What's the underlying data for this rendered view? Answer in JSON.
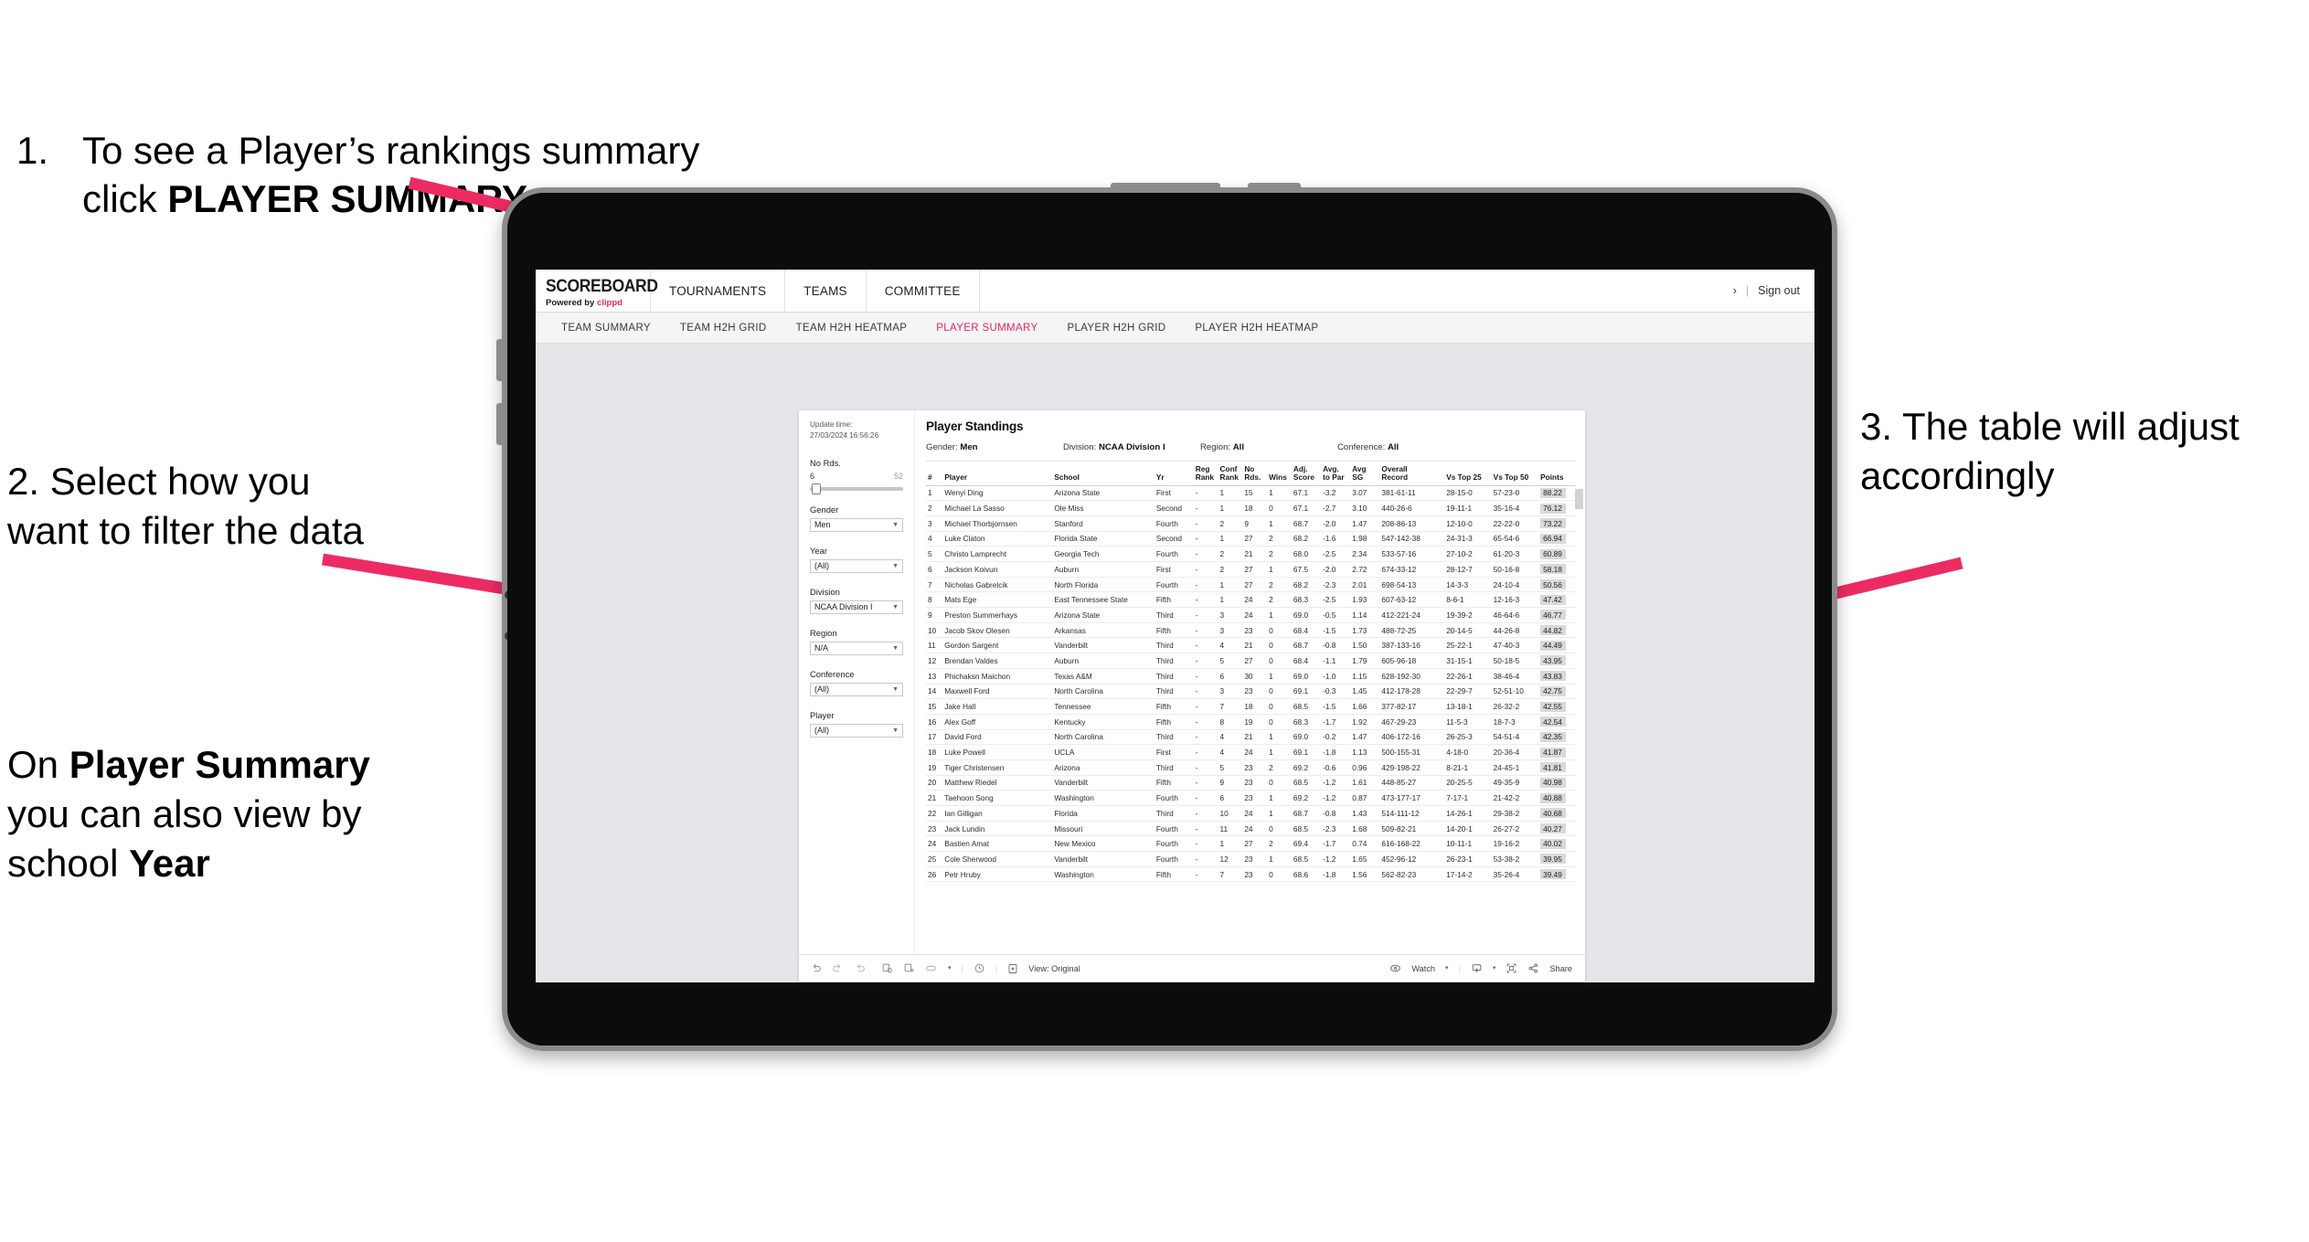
{
  "annotations": {
    "step1": {
      "number": "1.",
      "text_part1": "To see a Player’s rankings summary click ",
      "text_bold": "PLAYER SUMMARY"
    },
    "step2": {
      "line": "2. Select how you want to filter the data"
    },
    "step2b": {
      "pre": "On ",
      "bold1": "Player Summary",
      "mid": " you can also view by school ",
      "bold2": "Year"
    },
    "step3": {
      "line": "3. The table will adjust accordingly"
    }
  },
  "colors": {
    "accent_pink": "#e8275f",
    "arrow_pink": "#ed2b63",
    "screen_bg": "#e4e6e9",
    "bezel": "#0c0c0c",
    "frame": "#8b8b8b"
  },
  "app": {
    "brand": {
      "name": "SCOREBOARD",
      "powered_prefix": "Powered by ",
      "powered_brand": "clippd"
    },
    "top_nav": [
      "TOURNAMENTS",
      "TEAMS",
      "COMMITTEE"
    ],
    "top_right": {
      "user_glyph": "›",
      "separator": "|",
      "sign_out": "Sign out"
    },
    "sub_tabs": [
      {
        "label": "TEAM SUMMARY",
        "active": false
      },
      {
        "label": "TEAM H2H GRID",
        "active": false
      },
      {
        "label": "TEAM H2H HEATMAP",
        "active": false
      },
      {
        "label": "PLAYER SUMMARY",
        "active": true
      },
      {
        "label": "PLAYER H2H GRID",
        "active": false
      },
      {
        "label": "PLAYER H2H HEATMAP",
        "active": false
      }
    ]
  },
  "sheet": {
    "update_time_label": "Update time:",
    "update_time_value": "27/03/2024 16:56:26",
    "title": "Player Standings",
    "filter_summary": [
      {
        "label": "Gender:",
        "value": "Men"
      },
      {
        "label": "Division:",
        "value": "NCAA Division I"
      },
      {
        "label": "Region:",
        "value": "All"
      },
      {
        "label": "Conference:",
        "value": "All"
      }
    ],
    "filters": {
      "slider": {
        "label": "No Rds.",
        "min": "6",
        "max": "52"
      },
      "selects": [
        {
          "label": "Gender",
          "value": "Men"
        },
        {
          "label": "Year",
          "value": "(All)"
        },
        {
          "label": "Division",
          "value": "NCAA Division I"
        },
        {
          "label": "Region",
          "value": "N/A"
        },
        {
          "label": "Conference",
          "value": "(All)"
        },
        {
          "label": "Player",
          "value": "(All)"
        }
      ]
    },
    "toolbar": {
      "undo_icon": "undo-icon",
      "redo_icon": "redo-icon",
      "revert_icon": "revert-icon",
      "refresh_icon": "refresh-data-icon",
      "pause_icon": "pause-updates-icon",
      "device_icon": "device-layout-icon",
      "device_caret": "▾",
      "alerts_icon": "alerts-icon",
      "view_icon": "view-icon",
      "view_label": "View: Original",
      "watch_icon": "watch-eye-icon",
      "watch_label": "Watch",
      "watch_caret": "▾",
      "download_icon": "download-icon",
      "download_caret": "▾",
      "fullscreen_icon": "fullscreen-icon",
      "share_icon": "share-icon",
      "share_label": "Share"
    }
  },
  "chart_data": {
    "type": "table",
    "title": "Player Standings",
    "columns": [
      "#",
      "Player",
      "School",
      "Yr",
      "Reg Rank",
      "Conf Rank",
      "No Rds.",
      "Wins",
      "Adj. Score",
      "Avg. to Par",
      "Avg SG",
      "Overall Record",
      "Vs Top 25",
      "Vs Top 50",
      "Points"
    ],
    "column_headers_wrapped": [
      {
        "l1": "#",
        "l2": ""
      },
      {
        "l1": "Player",
        "l2": ""
      },
      {
        "l1": "School",
        "l2": ""
      },
      {
        "l1": "Yr",
        "l2": ""
      },
      {
        "l1": "Reg",
        "l2": "Rank"
      },
      {
        "l1": "Conf",
        "l2": "Rank"
      },
      {
        "l1": "No",
        "l2": "Rds."
      },
      {
        "l1": "Wins",
        "l2": ""
      },
      {
        "l1": "Adj.",
        "l2": "Score"
      },
      {
        "l1": "Avg.",
        "l2": "to Par"
      },
      {
        "l1": "Avg",
        "l2": "SG"
      },
      {
        "l1": "Overall",
        "l2": "Record"
      },
      {
        "l1": "Vs Top 25",
        "l2": ""
      },
      {
        "l1": "Vs Top 50",
        "l2": ""
      },
      {
        "l1": "Points",
        "l2": ""
      }
    ],
    "rows": [
      [
        "1",
        "Wenyi Ding",
        "Arizona State",
        "First",
        "-",
        "1",
        "15",
        "1",
        "67.1",
        "-3.2",
        "3.07",
        "381-61-11",
        "28-15-0",
        "57-23-0",
        "88.22"
      ],
      [
        "2",
        "Michael La Sasso",
        "Ole Miss",
        "Second",
        "-",
        "1",
        "18",
        "0",
        "67.1",
        "-2.7",
        "3.10",
        "440-26-6",
        "19-11-1",
        "35-16-4",
        "76.12"
      ],
      [
        "3",
        "Michael Thorbjornsen",
        "Stanford",
        "Fourth",
        "-",
        "2",
        "9",
        "1",
        "68.7",
        "-2.0",
        "1.47",
        "208-86-13",
        "12-10-0",
        "22-22-0",
        "73.22"
      ],
      [
        "4",
        "Luke Claton",
        "Florida State",
        "Second",
        "-",
        "1",
        "27",
        "2",
        "68.2",
        "-1.6",
        "1.98",
        "547-142-38",
        "24-31-3",
        "65-54-6",
        "66.94"
      ],
      [
        "5",
        "Christo Lamprecht",
        "Georgia Tech",
        "Fourth",
        "-",
        "2",
        "21",
        "2",
        "68.0",
        "-2.5",
        "2.34",
        "533-57-16",
        "27-10-2",
        "61-20-3",
        "60.89"
      ],
      [
        "6",
        "Jackson Koivun",
        "Auburn",
        "First",
        "-",
        "2",
        "27",
        "1",
        "67.5",
        "-2.0",
        "2.72",
        "674-33-12",
        "28-12-7",
        "50-16-8",
        "58.18"
      ],
      [
        "7",
        "Nicholas Gabrelcik",
        "North Florida",
        "Fourth",
        "-",
        "1",
        "27",
        "2",
        "68.2",
        "-2.3",
        "2.01",
        "698-54-13",
        "14-3-3",
        "24-10-4",
        "50.56"
      ],
      [
        "8",
        "Mats Ege",
        "East Tennessee State",
        "Fifth",
        "-",
        "1",
        "24",
        "2",
        "68.3",
        "-2.5",
        "1.93",
        "607-63-12",
        "8-6-1",
        "12-16-3",
        "47.42"
      ],
      [
        "9",
        "Preston Summerhays",
        "Arizona State",
        "Third",
        "-",
        "3",
        "24",
        "1",
        "69.0",
        "-0.5",
        "1.14",
        "412-221-24",
        "19-39-2",
        "46-64-6",
        "46.77"
      ],
      [
        "10",
        "Jacob Skov Olesen",
        "Arkansas",
        "Fifth",
        "-",
        "3",
        "23",
        "0",
        "68.4",
        "-1.5",
        "1.73",
        "488-72-25",
        "20-14-5",
        "44-26-8",
        "44.82"
      ],
      [
        "11",
        "Gordon Sargent",
        "Vanderbilt",
        "Third",
        "-",
        "4",
        "21",
        "0",
        "68.7",
        "-0.8",
        "1.50",
        "387-133-16",
        "25-22-1",
        "47-40-3",
        "44.49"
      ],
      [
        "12",
        "Brendan Valdes",
        "Auburn",
        "Third",
        "-",
        "5",
        "27",
        "0",
        "68.4",
        "-1.1",
        "1.79",
        "605-96-18",
        "31-15-1",
        "50-18-5",
        "43.95"
      ],
      [
        "13",
        "Phichaksn Maichon",
        "Texas A&M",
        "Third",
        "-",
        "6",
        "30",
        "1",
        "69.0",
        "-1.0",
        "1.15",
        "628-192-30",
        "22-26-1",
        "38-46-4",
        "43.83"
      ],
      [
        "14",
        "Maxwell Ford",
        "North Carolina",
        "Third",
        "-",
        "3",
        "23",
        "0",
        "69.1",
        "-0.3",
        "1.45",
        "412-178-28",
        "22-29-7",
        "52-51-10",
        "42.75"
      ],
      [
        "15",
        "Jake Hall",
        "Tennessee",
        "Fifth",
        "-",
        "7",
        "18",
        "0",
        "68.5",
        "-1.5",
        "1.66",
        "377-82-17",
        "13-18-1",
        "26-32-2",
        "42.55"
      ],
      [
        "16",
        "Alex Goff",
        "Kentucky",
        "Fifth",
        "-",
        "8",
        "19",
        "0",
        "68.3",
        "-1.7",
        "1.92",
        "467-29-23",
        "11-5-3",
        "18-7-3",
        "42.54"
      ],
      [
        "17",
        "David Ford",
        "North Carolina",
        "Third",
        "-",
        "4",
        "21",
        "1",
        "69.0",
        "-0.2",
        "1.47",
        "406-172-16",
        "26-25-3",
        "54-51-4",
        "42.35"
      ],
      [
        "18",
        "Luke Powell",
        "UCLA",
        "First",
        "-",
        "4",
        "24",
        "1",
        "69.1",
        "-1.8",
        "1.13",
        "500-155-31",
        "4-18-0",
        "20-36-4",
        "41.87"
      ],
      [
        "19",
        "Tiger Christensen",
        "Arizona",
        "Third",
        "-",
        "5",
        "23",
        "2",
        "69.2",
        "-0.6",
        "0.96",
        "429-198-22",
        "8-21-1",
        "24-45-1",
        "41.81"
      ],
      [
        "20",
        "Matthew Riedel",
        "Vanderbilt",
        "Fifth",
        "-",
        "9",
        "23",
        "0",
        "68.5",
        "-1.2",
        "1.61",
        "448-85-27",
        "20-25-5",
        "49-35-9",
        "40.98"
      ],
      [
        "21",
        "Taehoon Song",
        "Washington",
        "Fourth",
        "-",
        "6",
        "23",
        "1",
        "69.2",
        "-1.2",
        "0.87",
        "473-177-17",
        "7-17-1",
        "21-42-2",
        "40.88"
      ],
      [
        "22",
        "Ian Gilligan",
        "Florida",
        "Third",
        "-",
        "10",
        "24",
        "1",
        "68.7",
        "-0.8",
        "1.43",
        "514-111-12",
        "14-26-1",
        "29-38-2",
        "40.68"
      ],
      [
        "23",
        "Jack Lundin",
        "Missouri",
        "Fourth",
        "-",
        "11",
        "24",
        "0",
        "68.5",
        "-2.3",
        "1.68",
        "509-82-21",
        "14-20-1",
        "26-27-2",
        "40.27"
      ],
      [
        "24",
        "Bastien Amat",
        "New Mexico",
        "Fourth",
        "-",
        "1",
        "27",
        "2",
        "69.4",
        "-1.7",
        "0.74",
        "616-168-22",
        "10-11-1",
        "19-16-2",
        "40.02"
      ],
      [
        "25",
        "Cole Sherwood",
        "Vanderbilt",
        "Fourth",
        "-",
        "12",
        "23",
        "1",
        "68.5",
        "-1.2",
        "1.65",
        "452-96-12",
        "26-23-1",
        "53-38-2",
        "39.95"
      ],
      [
        "26",
        "Petr Hruby",
        "Washington",
        "Fifth",
        "-",
        "7",
        "23",
        "0",
        "68.6",
        "-1.8",
        "1.56",
        "562-82-23",
        "17-14-2",
        "35-26-4",
        "39.49"
      ]
    ],
    "highlight_column": "Points"
  }
}
